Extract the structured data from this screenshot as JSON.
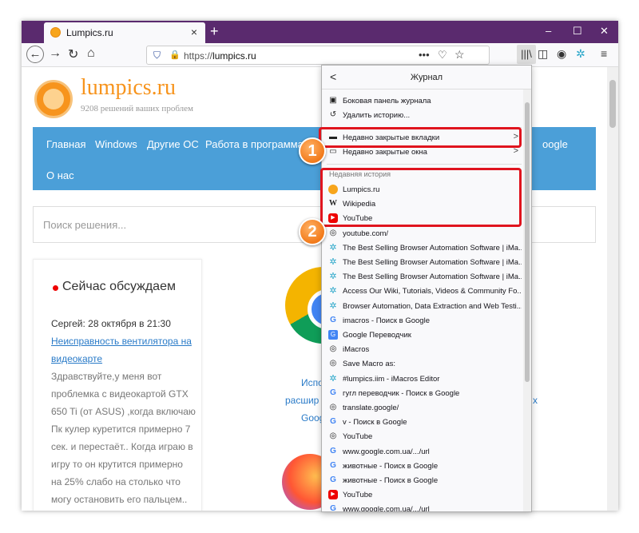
{
  "tab": {
    "title": "Lumpics.ru",
    "close": "×",
    "new": "+"
  },
  "window_controls": {
    "minimize": "–",
    "maximize": "☐",
    "close": "✕"
  },
  "nav": {
    "back": "←",
    "forward": "→",
    "reload": "↻",
    "home": "⌂"
  },
  "urlbar": {
    "scheme": "https://",
    "host": "lumpics.ru",
    "more": "•••"
  },
  "site": {
    "name": "lumpics.ru",
    "tagline": "9208 решений ваших проблем",
    "menu": [
      "Главная",
      "Windows",
      "Другие ОС",
      "Работа в программа",
      "oogle",
      "О нас"
    ],
    "search_placeholder": "Поиск решения...",
    "discuss": {
      "heading": "Сейчас обсуждаем",
      "author": "Сергей: 28 октября в 21:30",
      "link1": "Неисправность вентилятора на",
      "link2": "видеокарте",
      "lines": [
        "Здравствуйте,у меня вот",
        "проблемка с видеокартой GTX",
        "650 Ti (от ASUS) ,когда включаю",
        "Пк кулер куретится примерно 7",
        "сек. и перестаёт.. Когда играю в",
        "игру то он крутится примерно",
        "на 25% слабо на столько что",
        "могу остановить его пальцем.."
      ]
    },
    "partial_texts": [
      "Испо",
      "расшир",
      "Goog",
      "x"
    ]
  },
  "panel": {
    "title": "Журнал",
    "back": "<",
    "top_items": [
      {
        "icon": "sidebar-icon",
        "glyph": "▣",
        "label": "Боковая панель журнала"
      },
      {
        "icon": "history-clear-icon",
        "glyph": "↺",
        "label": "Удалить историю..."
      }
    ],
    "closed": [
      {
        "icon": "tabs-icon",
        "glyph": "▬",
        "label": "Недавно закрытые вкладки",
        "arrow": ">"
      },
      {
        "icon": "windows-icon",
        "glyph": "▭",
        "label": "Недавно закрытые окна",
        "arrow": ">"
      }
    ],
    "section_label": "Недавняя история",
    "history": [
      {
        "icon": "lumpics-icon",
        "cls": "ic-fox",
        "glyph": "",
        "label": "Lumpics.ru"
      },
      {
        "icon": "wikipedia-icon",
        "cls": "ic-w",
        "glyph": "W",
        "label": "Wikipedia"
      },
      {
        "icon": "youtube-icon",
        "cls": "ic-yt",
        "glyph": "▶",
        "label": "YouTube"
      },
      {
        "icon": "globe-icon",
        "cls": "ic-glob",
        "glyph": "◎",
        "label": "youtube.com/"
      },
      {
        "icon": "imacros-icon",
        "cls": "ic-im",
        "glyph": "✲",
        "label": "The Best Selling Browser Automation Software | iMa..."
      },
      {
        "icon": "imacros-icon",
        "cls": "ic-im",
        "glyph": "✲",
        "label": "The Best Selling Browser Automation Software | iMa..."
      },
      {
        "icon": "imacros-icon",
        "cls": "ic-im",
        "glyph": "✲",
        "label": "The Best Selling Browser Automation Software | iMa..."
      },
      {
        "icon": "imacros-icon",
        "cls": "ic-im",
        "glyph": "✲",
        "label": "Access Our Wiki, Tutorials, Videos & Community Fo..."
      },
      {
        "icon": "imacros-icon",
        "cls": "ic-im",
        "glyph": "✲",
        "label": "Browser Automation, Data Extraction and Web Testi..."
      },
      {
        "icon": "google-icon",
        "cls": "ic-g",
        "glyph": "G",
        "label": "imacros - Поиск в Google"
      },
      {
        "icon": "google-translate-icon",
        "cls": "ic-gt",
        "glyph": "G",
        "label": "Google Переводчик"
      },
      {
        "icon": "globe-icon",
        "cls": "ic-glob",
        "glyph": "◎",
        "label": "iMacros"
      },
      {
        "icon": "globe-icon",
        "cls": "ic-glob",
        "glyph": "◎",
        "label": "Save Macro as:"
      },
      {
        "icon": "imacros-icon",
        "cls": "ic-im",
        "glyph": "✲",
        "label": "#lumpics.iim - iMacros Editor"
      },
      {
        "icon": "google-icon",
        "cls": "ic-g",
        "glyph": "G",
        "label": "гугл переводчик - Поиск в Google"
      },
      {
        "icon": "globe-icon",
        "cls": "ic-glob",
        "glyph": "◎",
        "label": "translate.google/"
      },
      {
        "icon": "google-icon",
        "cls": "ic-g",
        "glyph": "G",
        "label": "v - Поиск в Google"
      },
      {
        "icon": "globe-icon",
        "cls": "ic-glob",
        "glyph": "◎",
        "label": "YouTube"
      },
      {
        "icon": "google-icon",
        "cls": "ic-g",
        "glyph": "G",
        "label": "www.google.com.ua/.../url"
      },
      {
        "icon": "google-icon",
        "cls": "ic-g",
        "glyph": "G",
        "label": "животные - Поиск в Google"
      },
      {
        "icon": "google-icon",
        "cls": "ic-g",
        "glyph": "G",
        "label": "животные - Поиск в Google"
      },
      {
        "icon": "youtube-icon",
        "cls": "ic-yt",
        "glyph": "▶",
        "label": "YouTube"
      },
      {
        "icon": "google-icon",
        "cls": "ic-g",
        "glyph": "G",
        "label": "www.google.com.ua/.../url"
      }
    ]
  },
  "badges": [
    "1",
    "2"
  ],
  "colors": {
    "tabstrip": "#5a2a6e",
    "menu": "#4b9fd8",
    "accent": "#f7941d",
    "highlight": "#e0141e"
  }
}
